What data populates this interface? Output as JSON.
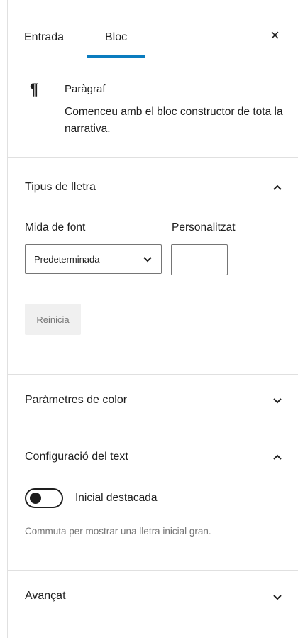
{
  "tabs": {
    "entrada": "Entrada",
    "bloc": "Bloc"
  },
  "close_symbol": "×",
  "block": {
    "icon": "¶",
    "title": "Paràgraf",
    "description": "Comenceu amb el bloc constructor de tota la narrativa."
  },
  "typography": {
    "title": "Tipus de lletra",
    "font_size_label": "Mida de font",
    "custom_label": "Personalitzat",
    "select_value": "Predeterminada",
    "custom_value": "",
    "reset_label": "Reinicia",
    "expanded": true
  },
  "color": {
    "title": "Paràmetres de color",
    "expanded": false
  },
  "text": {
    "title": "Configuració del text",
    "toggle_label": "Inicial destacada",
    "toggle_on": false,
    "help": "Commuta per mostrar una lletra inicial gran.",
    "expanded": true
  },
  "advanced": {
    "title": "Avançat",
    "expanded": false
  },
  "colors": {
    "accent": "#0a7cbf",
    "text": "#1e1e1e",
    "muted": "#757575",
    "border": "#e0e0e0"
  },
  "icons": {
    "close": "close-icon",
    "paragraph": "paragraph-icon",
    "chevron_up": "chevron-up-icon",
    "chevron_down": "chevron-down-icon"
  }
}
